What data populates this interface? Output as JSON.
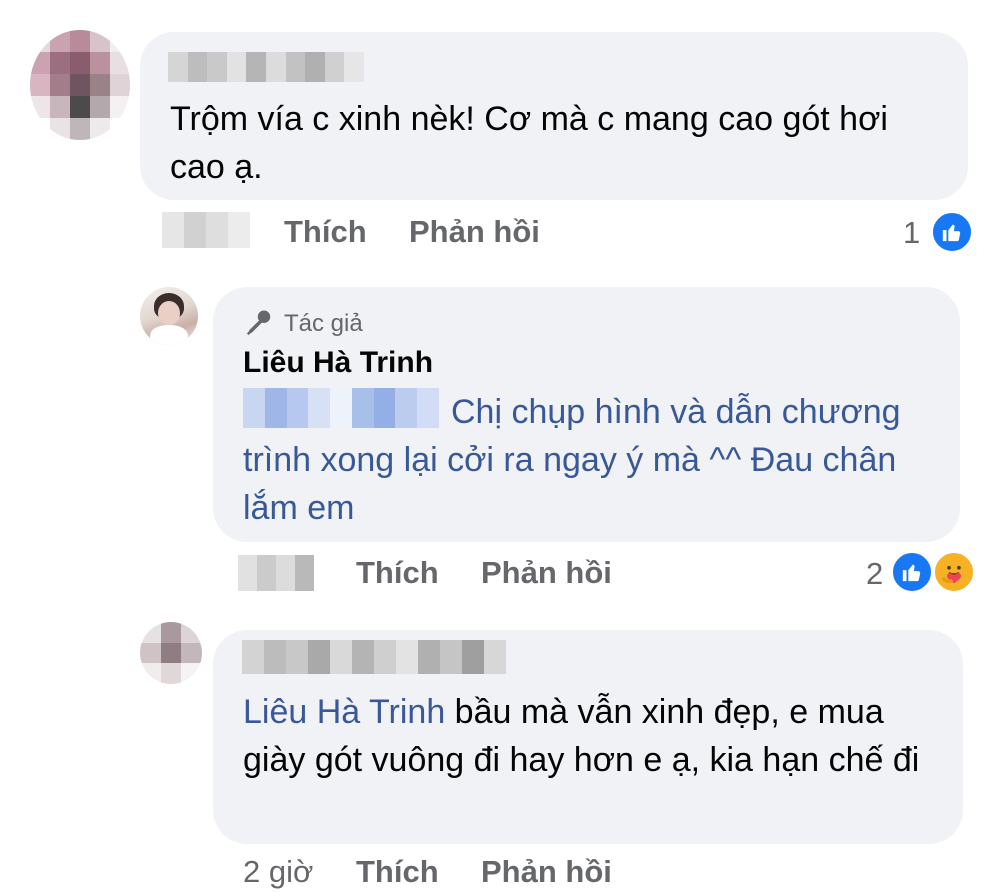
{
  "comments": [
    {
      "text": "Trộm vía c xinh nèk! Cơ mà c mang cao gót hơi cao ạ.",
      "actions": {
        "like": "Thích",
        "reply": "Phản hồi"
      },
      "reaction_count": "1"
    },
    {
      "author_badge": "Tác giả",
      "author": "Liêu Hà Trinh",
      "text": "Chị chụp hình và dẫn chương trình xong lại cởi ra ngay ý mà ^^ Đau chân lắm em",
      "actions": {
        "like": "Thích",
        "reply": "Phản hồi"
      },
      "reaction_count": "2"
    },
    {
      "mention": "Liêu Hà Trinh",
      "text": " bầu mà vẫn xinh đẹp, e mua giày gót vuông đi hay hơn e ạ, kia hạn chế đi",
      "timestamp": "2 giờ",
      "actions": {
        "like": "Thích",
        "reply": "Phản hồi"
      }
    }
  ],
  "colors": {
    "like_blue": "#1877f2",
    "mention": "#385898",
    "bubble": "#f0f2f5",
    "muted": "#65676b"
  },
  "icons": [
    "like-reaction-icon",
    "care-reaction-icon",
    "author-badge-icon"
  ]
}
